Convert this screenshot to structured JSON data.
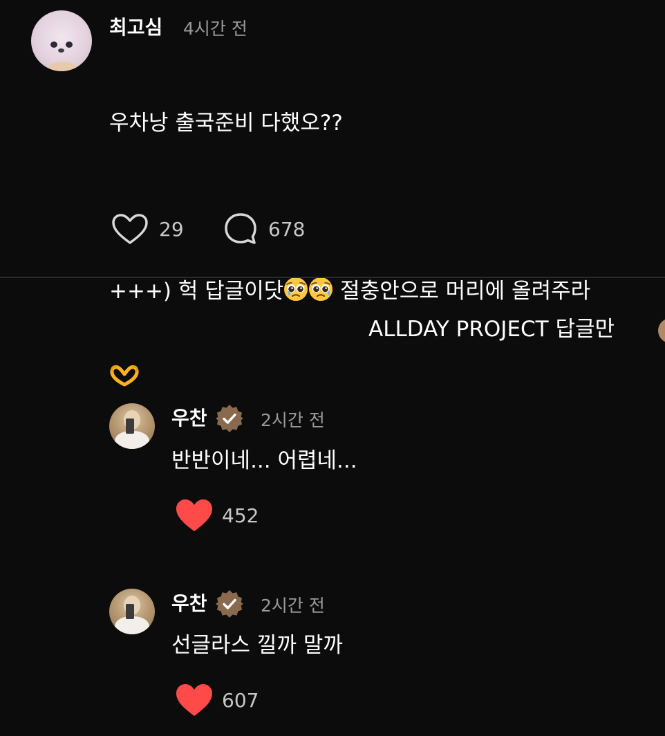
{
  "post": {
    "username": "최고심",
    "time": "4시간 전",
    "text_line1": "우차낭 출국준비 다했오??",
    "text_line3_prefix": "+++) 헉 답글이닷",
    "text_line3_suffix": " 절충안으로 머리에 올려주라",
    "emoji_pleading": "🥹",
    "emoji_heart_hands": "🫶",
    "likes": "29",
    "replies": "678"
  },
  "filter": {
    "label": "ALLDAY PROJECT 답글만"
  },
  "replies": [
    {
      "username": "우찬",
      "time": "2시간 전",
      "text": "반반이네... 어렵네...",
      "likes": "452",
      "liked": true
    },
    {
      "username": "우찬",
      "time": "2시간 전",
      "text": "선글라스 낄까 말까",
      "likes": "607",
      "liked": true
    }
  ],
  "colors": {
    "background": "#0c0c0c",
    "liked_heart": "#ff4a4a",
    "verified_badge": "#8a6a4e",
    "secondary_text": "#9a9a9a"
  },
  "icons": {
    "like": "heart-outline-icon",
    "reply": "speech-bubble-icon",
    "verified": "verified-badge-icon",
    "liked": "heart-filled-icon"
  }
}
